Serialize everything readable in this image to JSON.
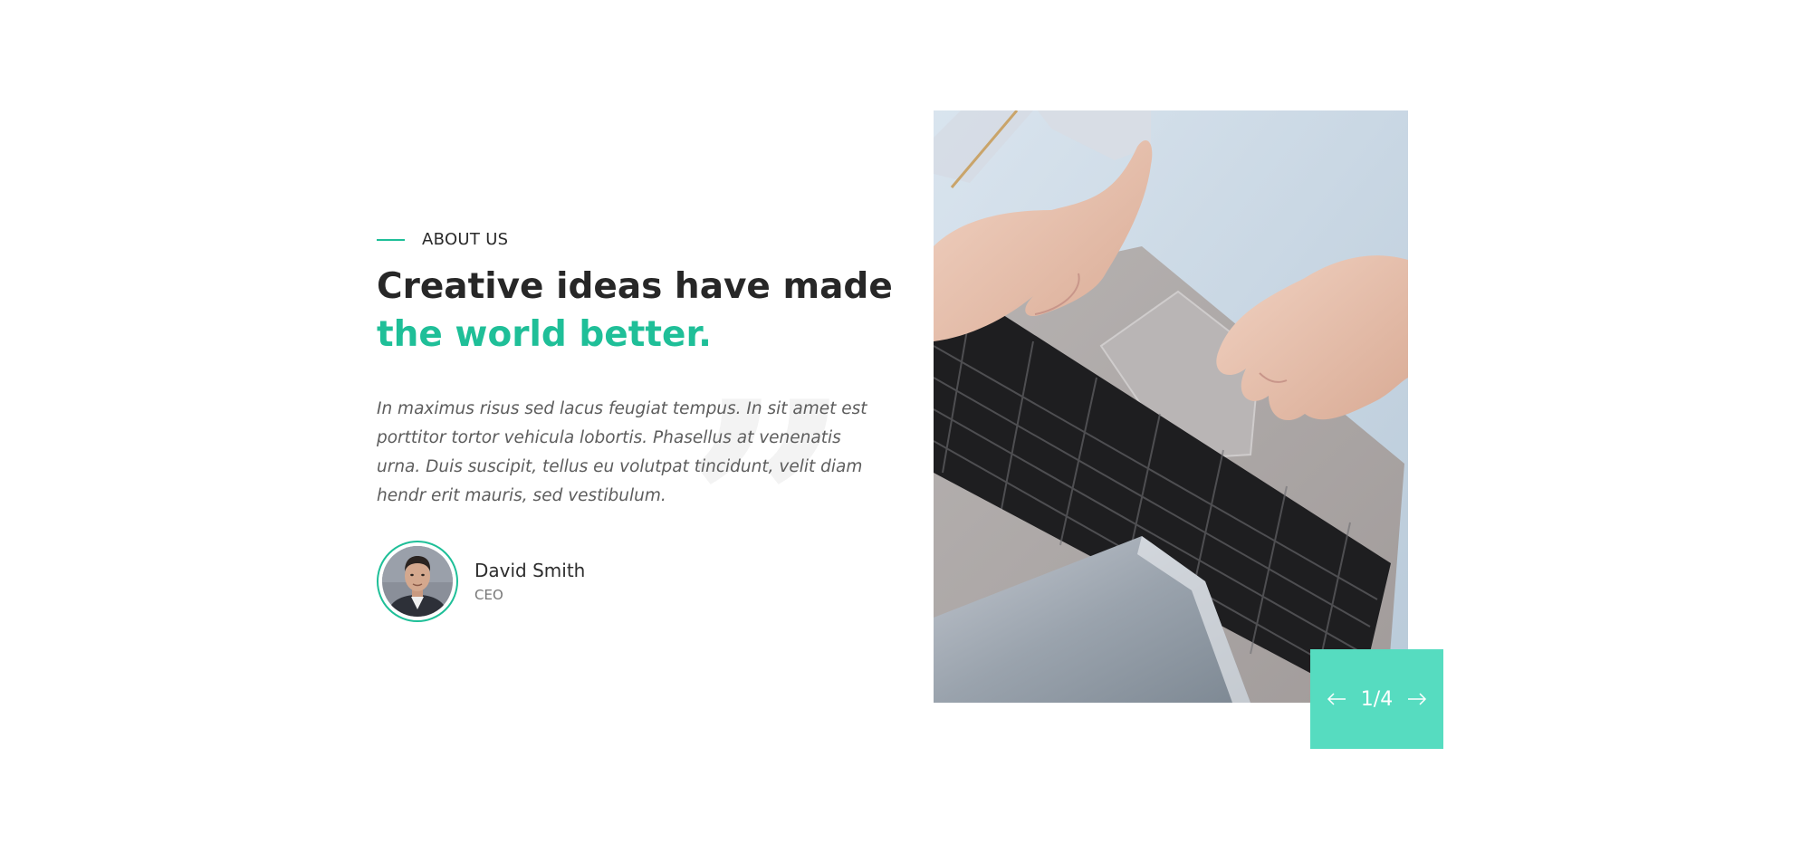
{
  "about": {
    "label": "ABOUT US"
  },
  "headline": {
    "line1": "Creative ideas have made",
    "line2": "the world better."
  },
  "quote": {
    "text": "In maximus risus sed lacus feugiat tempus. In sit amet est porttitor tortor vehicula lobortis. Phasellus at venenatis urna. Duis suscipit, tellus eu volutpat tincidunt, velit diam hendr erit mauris, sed vestibulum.",
    "icon": "quote-mark-icon"
  },
  "author": {
    "name": "David Smith",
    "role": "CEO"
  },
  "slider": {
    "counter": "1/4",
    "prev_icon": "arrow-left-icon",
    "next_icon": "arrow-right-icon"
  },
  "colors": {
    "accent": "#1fbf98",
    "nav_bg": "#56dcc0",
    "heading": "#272727",
    "body_text": "#5d5d5d"
  }
}
